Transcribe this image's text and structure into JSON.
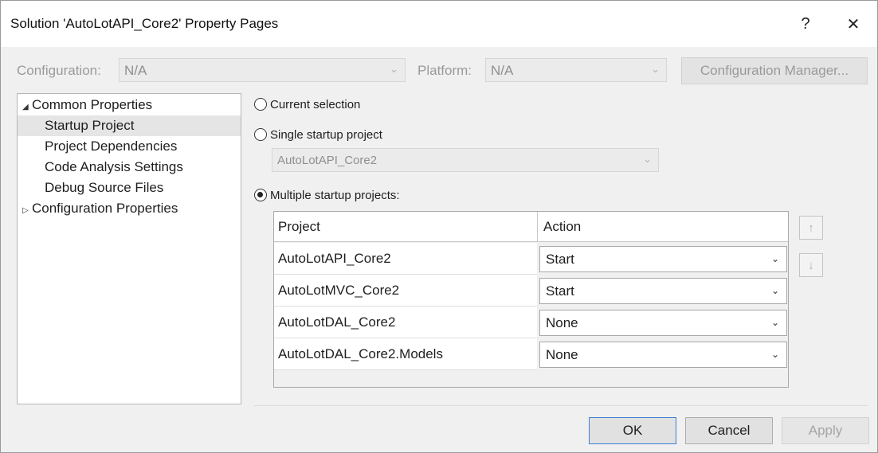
{
  "window": {
    "title": "Solution 'AutoLotAPI_Core2' Property Pages",
    "help_glyph": "?",
    "close_glyph": "✕"
  },
  "config": {
    "configuration_label": "Configuration:",
    "configuration_value": "N/A",
    "platform_label": "Platform:",
    "platform_value": "N/A",
    "manager_button": "Configuration Manager..."
  },
  "tree": {
    "items": [
      {
        "label": "Common Properties",
        "arrow": "◢"
      },
      {
        "label": "Startup Project"
      },
      {
        "label": "Project Dependencies"
      },
      {
        "label": "Code Analysis Settings"
      },
      {
        "label": "Debug Source Files"
      },
      {
        "label": "Configuration Properties",
        "arrow": "▷"
      }
    ]
  },
  "startup": {
    "current_selection": "Current selection",
    "single_startup": "Single startup project",
    "single_project_value": "AutoLotAPI_Core2",
    "multiple_startup": "Multiple startup projects:",
    "selected_mode": "multiple"
  },
  "grid": {
    "columns": [
      "Project",
      "Action"
    ],
    "rows": [
      {
        "project": "AutoLotAPI_Core2",
        "action": "Start"
      },
      {
        "project": "AutoLotMVC_Core2",
        "action": "Start"
      },
      {
        "project": "AutoLotDAL_Core2",
        "action": "None"
      },
      {
        "project": "AutoLotDAL_Core2.Models",
        "action": "None"
      }
    ]
  },
  "side_buttons": {
    "move_up": "↑",
    "move_down": "↓"
  },
  "footer": {
    "ok": "OK",
    "cancel": "Cancel",
    "apply": "Apply"
  },
  "icons": {
    "chevron": "⌄"
  }
}
